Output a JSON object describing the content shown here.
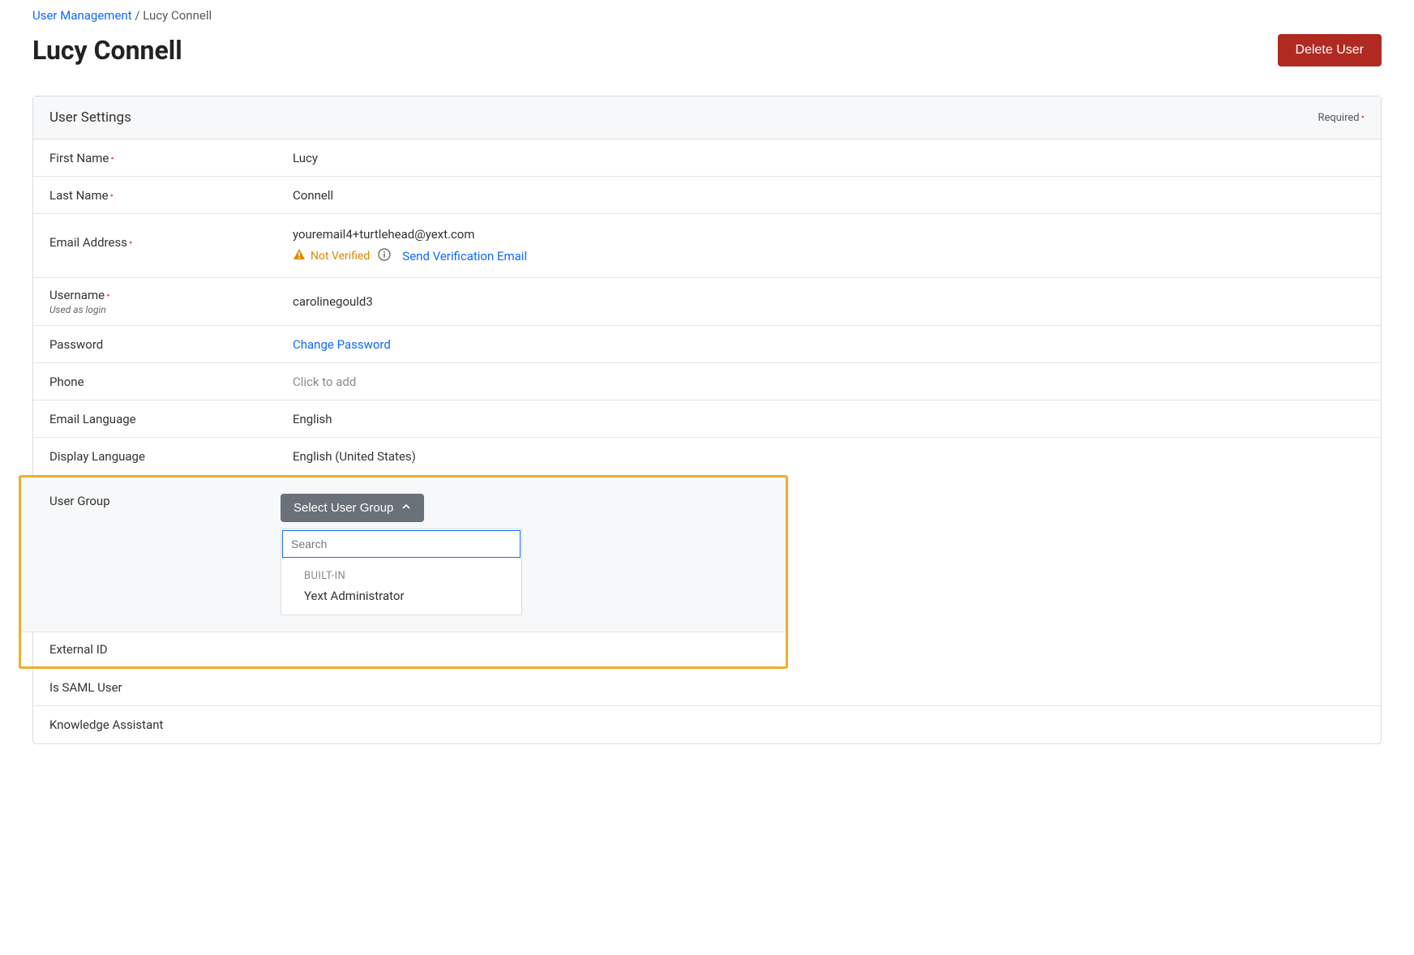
{
  "breadcrumb": {
    "parent": "User Management",
    "sep": "/",
    "current": "Lucy Connell"
  },
  "page_title": "Lucy Connell",
  "delete_button": "Delete User",
  "panel": {
    "title": "User Settings",
    "required_note": "Required"
  },
  "fields": {
    "first_name": {
      "label": "First Name",
      "value": "Lucy"
    },
    "last_name": {
      "label": "Last Name",
      "value": "Connell"
    },
    "email": {
      "label": "Email Address",
      "value": "youremail4+turtlehead@yext.com",
      "not_verified": "Not Verified",
      "send_verification": "Send Verification Email"
    },
    "username": {
      "label": "Username",
      "hint": "Used as login",
      "value": "carolinegould3"
    },
    "password": {
      "label": "Password",
      "change": "Change Password"
    },
    "phone": {
      "label": "Phone",
      "placeholder": "Click to add"
    },
    "email_language": {
      "label": "Email Language",
      "value": "English"
    },
    "display_language": {
      "label": "Display Language",
      "value": "English (United States)"
    },
    "user_group": {
      "label": "User Group",
      "button": "Select User Group",
      "search_placeholder": "Search",
      "section_label": "BUILT-IN",
      "option1": "Yext Administrator"
    },
    "external_id": {
      "label": "External ID"
    },
    "is_saml": {
      "label": "Is SAML User"
    },
    "knowledge_assistant": {
      "label": "Knowledge Assistant"
    }
  }
}
